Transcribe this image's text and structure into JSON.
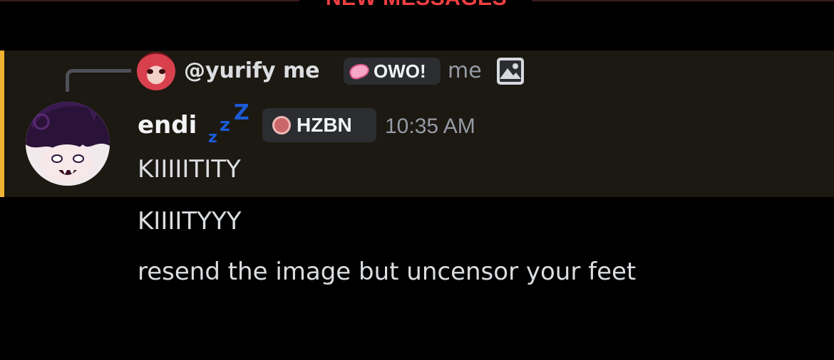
{
  "divider": {
    "label": "NEW MESSAGES",
    "color": "#f23f43"
  },
  "reply": {
    "author": "@yurify me",
    "tag": "OWO!",
    "tag_icon": "pink-blob-icon",
    "preview": "me",
    "attachment_icon": "image-icon"
  },
  "message": {
    "author": "endi",
    "status_icon": "sleeping-zzz-icon",
    "tag": "HZBN",
    "tag_icon": "hzbn-logo-icon",
    "timestamp": "10:35 AM",
    "lines": [
      "KIIIIITITY",
      "KIIIITYYY",
      "resend the image but uncensor your feet"
    ]
  },
  "colors": {
    "background": "#000000",
    "mention_highlight": "#1c1812",
    "mention_bar": "#f0b232",
    "zzz": "#1a5bd6"
  }
}
